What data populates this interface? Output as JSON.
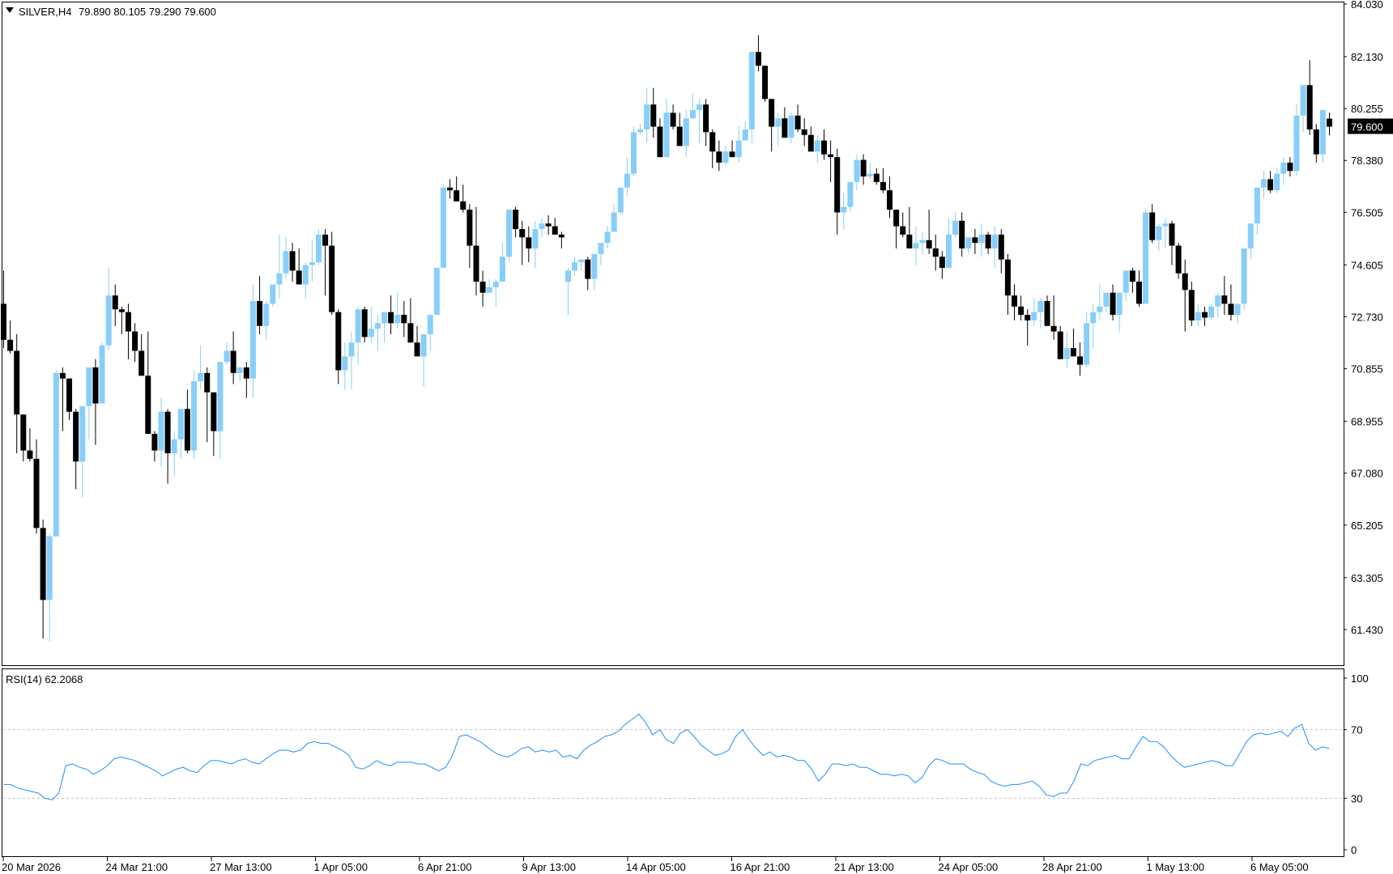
{
  "header": {
    "symbol_label": "SILVER,H4",
    "ohlc_label": "79.890 80.105 79.290 79.600"
  },
  "colors": {
    "bull": "#87cefa",
    "bear": "#000000",
    "rsi_line": "#1e90ff",
    "grid_level": "#c0c0c0",
    "price_tag_bg": "#000000",
    "price_tag_text": "#ffffff"
  },
  "price_axis": {
    "min": 60.2,
    "max": 84.03,
    "tick_labels": [
      "84.030",
      "82.130",
      "80.255",
      "78.380",
      "76.505",
      "74.605",
      "72.730",
      "70.855",
      "68.955",
      "67.080",
      "65.205",
      "63.305",
      "61.430"
    ],
    "last_price_label": "79.600"
  },
  "rsi_panel": {
    "label": "RSI(14) 62.2068",
    "levels": [
      70,
      30
    ],
    "tick_labels": [
      "100",
      "70",
      "30",
      "0"
    ]
  },
  "time_axis": {
    "labels": [
      "20 Mar 2026",
      "24 Mar 21:00",
      "27 Mar 13:00",
      "1 Apr 05:00",
      "6 Apr 21:00",
      "9 Apr 13:00",
      "14 Apr 05:00",
      "16 Apr 21:00",
      "21 Apr 13:00",
      "24 Apr 05:00",
      "28 Apr 21:00",
      "1 May 13:00",
      "6 May 05:00"
    ]
  },
  "chart_data": {
    "type": "candlestick",
    "title": "SILVER,H4",
    "timeframe": "H4",
    "ylim": [
      60.2,
      84.03
    ],
    "xlabel": "",
    "ylabel": "",
    "grid": false,
    "legend": "none",
    "candles": [
      [
        73.2,
        74.4,
        71.6,
        71.9
      ],
      [
        71.9,
        72.6,
        71.4,
        71.5
      ],
      [
        71.5,
        72.1,
        67.8,
        69.2
      ],
      [
        69.2,
        69.2,
        67.5,
        67.9
      ],
      [
        67.9,
        68.7,
        67.5,
        67.6
      ],
      [
        67.6,
        68.3,
        64.9,
        65.1
      ],
      [
        65.1,
        65.4,
        61.1,
        62.5
      ],
      [
        62.5,
        64.9,
        61.0,
        64.8
      ],
      [
        64.8,
        70.8,
        64.8,
        70.7
      ],
      [
        70.7,
        70.9,
        68.6,
        70.5
      ],
      [
        70.5,
        70.5,
        69.0,
        69.3
      ],
      [
        69.3,
        69.4,
        66.5,
        67.5
      ],
      [
        67.5,
        69.3,
        66.2,
        69.5
      ],
      [
        69.5,
        70.8,
        68.3,
        70.9
      ],
      [
        70.9,
        71.2,
        68.1,
        69.6
      ],
      [
        69.6,
        71.8,
        69.6,
        71.7
      ],
      [
        71.7,
        74.5,
        71.5,
        73.5
      ],
      [
        73.5,
        73.9,
        72.4,
        73.0
      ],
      [
        73.0,
        73.1,
        72.1,
        72.9
      ],
      [
        72.9,
        73.2,
        71.2,
        72.2
      ],
      [
        72.2,
        72.5,
        71.1,
        71.5
      ],
      [
        71.5,
        72.1,
        71.0,
        70.6
      ],
      [
        70.6,
        72.2,
        70.6,
        68.5
      ],
      [
        68.5,
        68.6,
        67.5,
        67.9
      ],
      [
        67.9,
        69.8,
        67.3,
        69.3
      ],
      [
        69.3,
        69.4,
        66.7,
        67.8
      ],
      [
        67.8,
        68.6,
        67.0,
        68.3
      ],
      [
        68.3,
        69.1,
        67.6,
        69.4
      ],
      [
        69.4,
        70.1,
        67.8,
        67.9
      ],
      [
        67.9,
        70.8,
        67.6,
        70.4
      ],
      [
        70.4,
        71.7,
        70.1,
        70.7
      ],
      [
        70.7,
        70.9,
        68.2,
        70.0
      ],
      [
        70.0,
        70.0,
        67.7,
        68.6
      ],
      [
        68.6,
        70.9,
        67.6,
        71.1
      ],
      [
        71.1,
        71.8,
        71.0,
        71.5
      ],
      [
        71.5,
        72.2,
        70.3,
        70.7
      ],
      [
        70.7,
        70.9,
        70.4,
        70.9
      ],
      [
        70.9,
        71.1,
        69.8,
        70.5
      ],
      [
        70.5,
        73.9,
        69.8,
        73.3
      ],
      [
        73.3,
        74.2,
        72.1,
        72.4
      ],
      [
        72.4,
        73.3,
        71.9,
        73.2
      ],
      [
        73.2,
        73.8,
        73.1,
        73.9
      ],
      [
        73.9,
        75.7,
        73.4,
        74.3
      ],
      [
        74.3,
        75.6,
        74.1,
        75.1
      ],
      [
        75.1,
        75.4,
        74.0,
        74.4
      ],
      [
        74.4,
        75.2,
        74.0,
        73.9
      ],
      [
        73.9,
        74.7,
        73.4,
        74.6
      ],
      [
        74.6,
        75.5,
        74.0,
        74.7
      ],
      [
        74.7,
        75.9,
        74.6,
        75.7
      ],
      [
        75.7,
        75.9,
        73.5,
        75.3
      ],
      [
        75.3,
        75.8,
        72.8,
        72.9
      ],
      [
        72.9,
        73.0,
        70.3,
        70.8
      ],
      [
        70.8,
        71.8,
        70.1,
        71.3
      ],
      [
        71.3,
        72.2,
        70.1,
        71.8
      ],
      [
        71.8,
        73.1,
        71.0,
        73.0
      ],
      [
        73.0,
        73.1,
        71.8,
        72.0
      ],
      [
        72.0,
        73.1,
        71.8,
        72.3
      ],
      [
        72.3,
        72.8,
        71.5,
        72.5
      ],
      [
        72.5,
        72.7,
        71.8,
        72.9
      ],
      [
        72.9,
        73.5,
        72.1,
        72.5
      ],
      [
        72.5,
        73.6,
        72.3,
        72.8
      ],
      [
        72.8,
        73.3,
        72.0,
        72.5
      ],
      [
        72.5,
        73.4,
        72.2,
        71.8
      ],
      [
        71.8,
        72.4,
        71.3,
        71.3
      ],
      [
        71.3,
        72.0,
        70.2,
        72.1
      ],
      [
        72.1,
        72.5,
        71.5,
        72.8
      ],
      [
        72.8,
        74.4,
        72.8,
        74.5
      ],
      [
        74.5,
        77.5,
        74.5,
        77.4
      ],
      [
        77.4,
        77.7,
        77.0,
        77.3
      ],
      [
        77.3,
        77.8,
        76.9,
        76.9
      ],
      [
        76.9,
        77.5,
        76.5,
        76.6
      ],
      [
        76.6,
        76.8,
        74.5,
        75.3
      ],
      [
        75.3,
        76.7,
        73.5,
        74.0
      ],
      [
        74.0,
        74.4,
        73.1,
        73.6
      ],
      [
        73.6,
        74.1,
        73.6,
        73.8
      ],
      [
        73.8,
        74.1,
        73.1,
        74.0
      ],
      [
        74.0,
        75.4,
        74.0,
        74.9
      ],
      [
        74.9,
        76.5,
        74.7,
        76.6
      ],
      [
        76.6,
        76.7,
        75.6,
        75.9
      ],
      [
        75.9,
        76.2,
        74.6,
        75.6
      ],
      [
        75.6,
        76.0,
        74.7,
        75.2
      ],
      [
        75.2,
        76.2,
        74.5,
        75.9
      ],
      [
        75.9,
        76.3,
        75.6,
        76.1
      ],
      [
        76.1,
        76.4,
        75.7,
        76.0
      ],
      [
        76.0,
        76.3,
        75.8,
        75.7
      ],
      [
        75.7,
        75.8,
        75.2,
        75.6
      ],
      [
        74.0,
        74.5,
        72.8,
        74.4
      ],
      [
        74.4,
        74.9,
        74.2,
        74.7
      ],
      [
        74.7,
        74.8,
        74.4,
        74.8
      ],
      [
        74.8,
        74.9,
        73.7,
        74.1
      ],
      [
        74.1,
        74.5,
        73.7,
        75.0
      ],
      [
        75.0,
        75.4,
        74.6,
        75.4
      ],
      [
        75.4,
        76.0,
        75.2,
        75.8
      ],
      [
        75.8,
        76.8,
        75.8,
        76.5
      ],
      [
        76.5,
        77.4,
        76.4,
        77.4
      ],
      [
        77.4,
        78.5,
        77.1,
        77.9
      ],
      [
        77.9,
        79.6,
        77.8,
        79.4
      ],
      [
        79.4,
        79.7,
        79.3,
        79.5
      ],
      [
        79.5,
        81.0,
        79.0,
        80.4
      ],
      [
        80.4,
        81.0,
        79.2,
        79.6
      ],
      [
        79.6,
        79.9,
        78.5,
        78.5
      ],
      [
        78.5,
        80.6,
        78.5,
        80.1
      ],
      [
        80.1,
        80.4,
        79.5,
        79.6
      ],
      [
        79.6,
        80.1,
        78.9,
        78.9
      ],
      [
        78.9,
        80.2,
        78.5,
        79.9
      ],
      [
        79.9,
        80.8,
        79.9,
        80.2
      ],
      [
        80.2,
        80.6,
        79.0,
        80.4
      ],
      [
        80.4,
        80.6,
        78.9,
        79.4
      ],
      [
        79.4,
        79.5,
        78.1,
        78.7
      ],
      [
        78.7,
        79.1,
        78.0,
        78.3
      ],
      [
        78.3,
        78.9,
        78.2,
        78.7
      ],
      [
        78.7,
        79.1,
        78.7,
        78.5
      ],
      [
        78.5,
        79.6,
        78.3,
        79.1
      ],
      [
        79.1,
        79.8,
        79.1,
        79.5
      ],
      [
        79.5,
        80.9,
        79.0,
        82.3
      ],
      [
        82.3,
        82.9,
        81.6,
        81.8
      ],
      [
        81.8,
        81.8,
        80.5,
        80.6
      ],
      [
        80.6,
        80.6,
        78.7,
        79.6
      ],
      [
        79.6,
        80.1,
        78.9,
        79.9
      ],
      [
        79.9,
        80.3,
        79.2,
        79.2
      ],
      [
        79.2,
        80.1,
        79.0,
        80.0
      ],
      [
        80.0,
        80.4,
        79.4,
        79.5
      ],
      [
        79.5,
        79.9,
        78.9,
        79.3
      ],
      [
        79.3,
        79.6,
        78.8,
        78.7
      ],
      [
        78.7,
        79.3,
        78.3,
        79.1
      ],
      [
        79.1,
        79.5,
        78.4,
        78.6
      ],
      [
        78.6,
        79.1,
        77.6,
        78.5
      ],
      [
        78.5,
        78.8,
        75.7,
        76.5
      ],
      [
        76.5,
        77.2,
        75.9,
        76.7
      ],
      [
        76.7,
        77.5,
        76.5,
        77.6
      ],
      [
        77.6,
        78.6,
        77.3,
        78.4
      ],
      [
        78.4,
        78.6,
        77.5,
        77.8
      ],
      [
        77.8,
        78.3,
        77.7,
        77.9
      ],
      [
        77.9,
        78.1,
        77.5,
        77.6
      ],
      [
        77.6,
        78.1,
        77.2,
        77.3
      ],
      [
        77.3,
        77.8,
        76.3,
        76.6
      ],
      [
        76.6,
        76.6,
        75.2,
        76.0
      ],
      [
        76.0,
        76.5,
        75.6,
        75.7
      ],
      [
        75.7,
        76.7,
        75.3,
        75.2
      ],
      [
        75.2,
        76.0,
        74.6,
        75.4
      ],
      [
        75.4,
        75.8,
        75.0,
        75.5
      ],
      [
        75.5,
        76.6,
        75.0,
        75.2
      ],
      [
        75.2,
        75.7,
        74.4,
        74.9
      ],
      [
        74.9,
        75.1,
        74.1,
        74.5
      ],
      [
        74.5,
        76.3,
        74.5,
        75.7
      ],
      [
        75.7,
        76.5,
        75.6,
        76.2
      ],
      [
        76.2,
        76.5,
        74.9,
        75.2
      ],
      [
        75.2,
        75.6,
        75.0,
        75.6
      ],
      [
        75.6,
        75.9,
        75.0,
        75.4
      ],
      [
        75.4,
        76.1,
        74.9,
        75.7
      ],
      [
        75.7,
        75.8,
        75.0,
        75.2
      ],
      [
        75.2,
        76.0,
        74.5,
        75.7
      ],
      [
        75.7,
        75.9,
        74.3,
        74.8
      ],
      [
        74.8,
        75.0,
        72.8,
        73.5
      ],
      [
        73.5,
        73.9,
        72.6,
        73.1
      ],
      [
        73.1,
        73.5,
        72.6,
        72.8
      ],
      [
        72.8,
        73.0,
        71.7,
        72.6
      ],
      [
        72.6,
        73.4,
        72.4,
        72.9
      ],
      [
        72.9,
        73.4,
        72.3,
        73.3
      ],
      [
        73.3,
        73.5,
        72.7,
        72.4
      ],
      [
        72.4,
        73.5,
        71.9,
        72.2
      ],
      [
        72.2,
        72.4,
        71.2,
        71.2
      ],
      [
        71.2,
        72.2,
        70.9,
        71.6
      ],
      [
        71.6,
        72.3,
        71.3,
        71.3
      ],
      [
        71.3,
        71.8,
        70.6,
        71.0
      ],
      [
        71.0,
        72.9,
        70.9,
        72.5
      ],
      [
        72.5,
        73.2,
        71.6,
        72.9
      ],
      [
        72.9,
        73.9,
        72.6,
        73.1
      ],
      [
        73.1,
        73.6,
        72.9,
        73.6
      ],
      [
        73.6,
        73.9,
        72.6,
        72.8
      ],
      [
        72.8,
        73.6,
        72.2,
        73.6
      ],
      [
        73.6,
        74.3,
        73.3,
        74.4
      ],
      [
        74.4,
        74.5,
        73.6,
        74.0
      ],
      [
        74.0,
        74.4,
        73.1,
        73.2
      ],
      [
        73.2,
        76.6,
        73.2,
        76.5
      ],
      [
        76.5,
        76.8,
        75.4,
        75.5
      ],
      [
        75.5,
        76.1,
        75.1,
        76.0
      ],
      [
        76.0,
        76.3,
        75.2,
        76.1
      ],
      [
        76.1,
        76.2,
        74.6,
        75.3
      ],
      [
        75.3,
        75.4,
        74.1,
        74.3
      ],
      [
        74.3,
        74.8,
        72.2,
        73.7
      ],
      [
        73.7,
        74.0,
        72.4,
        72.6
      ],
      [
        72.6,
        73.2,
        72.4,
        72.9
      ],
      [
        72.9,
        73.1,
        72.4,
        72.7
      ],
      [
        72.7,
        73.2,
        72.6,
        73.1
      ],
      [
        73.1,
        73.6,
        72.7,
        73.5
      ],
      [
        73.5,
        74.2,
        72.8,
        73.2
      ],
      [
        73.2,
        73.9,
        72.6,
        72.8
      ],
      [
        72.8,
        73.2,
        72.5,
        73.2
      ],
      [
        73.2,
        74.7,
        73.0,
        75.2
      ],
      [
        75.2,
        76.1,
        74.8,
        76.1
      ],
      [
        76.1,
        77.3,
        75.7,
        77.4
      ],
      [
        77.4,
        78.0,
        77.0,
        77.7
      ],
      [
        77.7,
        78.0,
        77.2,
        77.3
      ],
      [
        77.3,
        78.1,
        77.2,
        77.9
      ],
      [
        77.9,
        78.5,
        77.5,
        78.3
      ],
      [
        78.3,
        78.5,
        77.8,
        78.0
      ],
      [
        78.0,
        80.4,
        77.8,
        80.0
      ],
      [
        80.0,
        81.0,
        79.4,
        81.1
      ],
      [
        81.1,
        82.0,
        79.3,
        79.5
      ],
      [
        79.5,
        79.7,
        78.3,
        78.6
      ],
      [
        78.6,
        80.0,
        78.3,
        80.2
      ],
      [
        79.89,
        80.105,
        79.29,
        79.6
      ]
    ],
    "rsi": [
      38,
      38,
      36,
      35,
      34,
      33,
      30,
      29,
      33,
      49,
      50,
      48,
      47,
      44,
      46,
      49,
      53,
      54,
      53,
      52,
      50,
      48,
      46,
      43,
      45,
      47,
      48,
      46,
      45,
      49,
      52,
      52,
      51,
      50,
      52,
      53,
      51,
      50,
      53,
      56,
      58,
      58,
      57,
      58,
      62,
      63,
      62,
      62,
      60,
      58,
      55,
      48,
      47,
      49,
      52,
      50,
      49,
      51,
      51,
      51,
      50,
      50,
      48,
      46,
      48,
      55,
      66,
      67,
      65,
      63,
      60,
      57,
      55,
      54,
      56,
      59,
      60,
      57,
      58,
      57,
      58,
      54,
      55,
      53,
      58,
      61,
      63,
      66,
      67,
      69,
      73,
      76,
      79,
      74,
      67,
      70,
      64,
      62,
      68,
      70,
      66,
      61,
      58,
      55,
      56,
      58,
      66,
      70,
      64,
      59,
      55,
      57,
      54,
      55,
      54,
      52,
      52,
      47,
      40,
      44,
      50,
      50,
      49,
      50,
      48,
      48,
      46,
      44,
      44,
      43,
      44,
      43,
      39,
      42,
      49,
      53,
      52,
      50,
      50,
      50,
      47,
      45,
      44,
      40,
      38,
      37,
      38,
      38,
      39,
      40,
      37,
      32,
      31,
      33,
      33,
      40,
      50,
      49,
      52,
      53,
      54,
      55,
      53,
      53,
      60,
      66,
      63,
      63,
      60,
      55,
      51,
      48,
      49,
      50,
      51,
      52,
      51,
      49,
      49,
      56,
      63,
      67,
      68,
      67,
      68,
      69,
      66,
      71,
      73,
      62,
      58,
      60,
      59
    ]
  }
}
